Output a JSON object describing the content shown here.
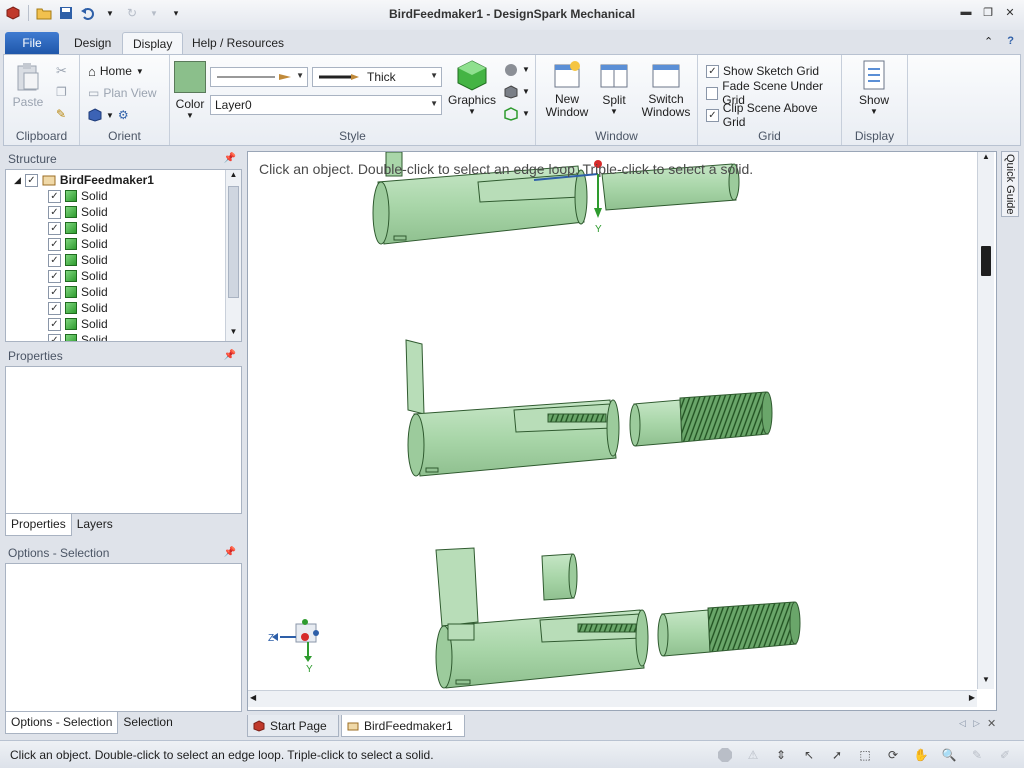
{
  "window": {
    "title": "BirdFeedmaker1 - DesignSpark Mechanical"
  },
  "tabs": {
    "file": "File",
    "design": "Design",
    "display": "Display",
    "help": "Help / Resources"
  },
  "ribbon": {
    "clipboard": {
      "label": "Clipboard",
      "paste": "Paste"
    },
    "orient": {
      "label": "Orient",
      "home": "Home",
      "plan_view": "Plan View"
    },
    "style": {
      "label": "Style",
      "color": "Color",
      "line_weight": "Thick",
      "layer": "Layer0",
      "graphics": "Graphics"
    },
    "window": {
      "label": "Window",
      "new_window": "New Window",
      "split": "Split",
      "switch_windows": "Switch Windows"
    },
    "grid": {
      "label": "Grid",
      "show_sketch_grid": "Show Sketch Grid",
      "fade_scene": "Fade Scene Under Grid",
      "clip_scene": "Clip Scene Above Grid"
    },
    "display": {
      "label": "Display",
      "show": "Show"
    }
  },
  "structure": {
    "title": "Structure",
    "root": "BirdFeedmaker1",
    "items": [
      "Solid",
      "Solid",
      "Solid",
      "Solid",
      "Solid",
      "Solid",
      "Solid",
      "Solid",
      "Solid",
      "Solid"
    ]
  },
  "properties": {
    "title": "Properties",
    "tab_properties": "Properties",
    "tab_layers": "Layers"
  },
  "options": {
    "title": "Options - Selection",
    "tab_options": "Options - Selection",
    "tab_selection": "Selection"
  },
  "viewport": {
    "hint": "Click an object. Double-click to select an edge loop. Triple-click to select a solid.",
    "axis_z": "Z",
    "axis_y": "Y",
    "quick_guide": "Quick Guide"
  },
  "doc_tabs": {
    "start": "Start Page",
    "doc": "BirdFeedmaker1"
  },
  "status": {
    "text": "Click an object. Double-click to select an edge loop. Triple-click to select a solid."
  },
  "colors": {
    "model": "#a9d7a9",
    "model_edge": "#2f5a2f",
    "file_tab": "#2a63b8"
  }
}
